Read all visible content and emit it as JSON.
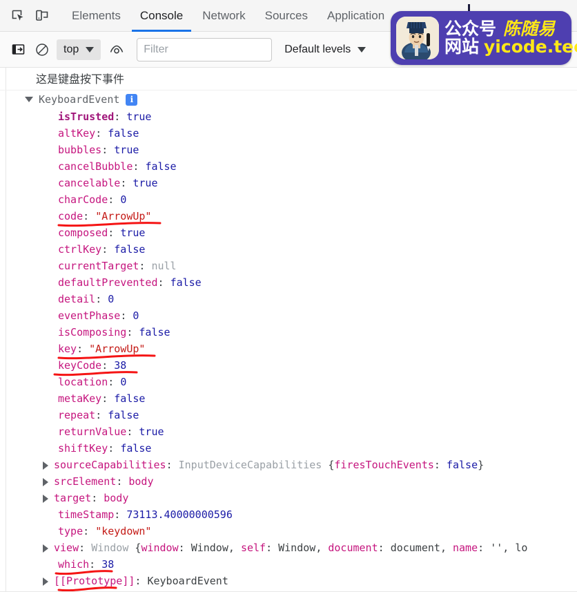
{
  "devtools": {
    "icons": {
      "inspect": "inspect-element-icon",
      "device": "device-toolbar-icon",
      "sidebar": "console-sidebar-icon",
      "clear": "clear-console-icon",
      "eye": "live-expression-icon"
    },
    "tabs": [
      {
        "label": "Elements",
        "active": false
      },
      {
        "label": "Console",
        "active": true
      },
      {
        "label": "Network",
        "active": false
      },
      {
        "label": "Sources",
        "active": false
      },
      {
        "label": "Application",
        "active": false
      }
    ],
    "toolbar": {
      "context": "top",
      "filter_value": "",
      "filter_placeholder": "Filter",
      "levels": "Default levels"
    },
    "accent_color": "#1a73e8",
    "annotation_color": "#f51414"
  },
  "console": {
    "message": "这是键盘按下事件",
    "object_name": "KeyboardEvent",
    "info_badge": "i",
    "properties": [
      {
        "key": "isTrusted",
        "value": "true",
        "type": "bool",
        "own": true,
        "expandable": false
      },
      {
        "key": "altKey",
        "value": "false",
        "type": "bool",
        "own": false,
        "expandable": false
      },
      {
        "key": "bubbles",
        "value": "true",
        "type": "bool",
        "own": false,
        "expandable": false
      },
      {
        "key": "cancelBubble",
        "value": "false",
        "type": "bool",
        "own": false,
        "expandable": false
      },
      {
        "key": "cancelable",
        "value": "true",
        "type": "bool",
        "own": false,
        "expandable": false
      },
      {
        "key": "charCode",
        "value": "0",
        "type": "num",
        "own": false,
        "expandable": false
      },
      {
        "key": "code",
        "value": "\"ArrowUp\"",
        "type": "str",
        "own": false,
        "expandable": false,
        "annotated": true
      },
      {
        "key": "composed",
        "value": "true",
        "type": "bool",
        "own": false,
        "expandable": false
      },
      {
        "key": "ctrlKey",
        "value": "false",
        "type": "bool",
        "own": false,
        "expandable": false
      },
      {
        "key": "currentTarget",
        "value": "null",
        "type": "null",
        "own": false,
        "expandable": false
      },
      {
        "key": "defaultPrevented",
        "value": "false",
        "type": "bool",
        "own": false,
        "expandable": false
      },
      {
        "key": "detail",
        "value": "0",
        "type": "num",
        "own": false,
        "expandable": false
      },
      {
        "key": "eventPhase",
        "value": "0",
        "type": "num",
        "own": false,
        "expandable": false
      },
      {
        "key": "isComposing",
        "value": "false",
        "type": "bool",
        "own": false,
        "expandable": false
      },
      {
        "key": "key",
        "value": "\"ArrowUp\"",
        "type": "str",
        "own": false,
        "expandable": false,
        "annotated": true
      },
      {
        "key": "keyCode",
        "value": "38",
        "type": "num",
        "own": false,
        "expandable": false,
        "annotated": true
      },
      {
        "key": "location",
        "value": "0",
        "type": "num",
        "own": false,
        "expandable": false
      },
      {
        "key": "metaKey",
        "value": "false",
        "type": "bool",
        "own": false,
        "expandable": false
      },
      {
        "key": "repeat",
        "value": "false",
        "type": "bool",
        "own": false,
        "expandable": false
      },
      {
        "key": "returnValue",
        "value": "true",
        "type": "bool",
        "own": false,
        "expandable": false
      },
      {
        "key": "shiftKey",
        "value": "false",
        "type": "bool",
        "own": false,
        "expandable": false
      },
      {
        "key": "sourceCapabilities",
        "value": "InputDeviceCapabilities {firesTouchEvents: false}",
        "type": "preview-idc",
        "own": false,
        "expandable": true
      },
      {
        "key": "srcElement",
        "value": "body",
        "type": "node",
        "own": false,
        "expandable": true
      },
      {
        "key": "target",
        "value": "body",
        "type": "node",
        "own": false,
        "expandable": true
      },
      {
        "key": "timeStamp",
        "value": "73113.40000000596",
        "type": "num",
        "own": false,
        "expandable": false
      },
      {
        "key": "type",
        "value": "\"keydown\"",
        "type": "str",
        "own": false,
        "expandable": false
      },
      {
        "key": "view",
        "value": "Window {window: Window, self: Window, document: document, name: '', lo",
        "type": "preview-window",
        "own": false,
        "expandable": true
      },
      {
        "key": "which",
        "value": "38",
        "type": "num",
        "own": false,
        "expandable": false,
        "annotated": true
      },
      {
        "key": "[[Prototype]]",
        "value": "KeyboardEvent",
        "type": "plain",
        "own": false,
        "expandable": true,
        "annotated": true
      }
    ]
  },
  "watermark": {
    "label_account": "公众号",
    "name": "陈随易",
    "label_site": "网站",
    "site": "yicode.tech",
    "bg_color": "#4e3fb0",
    "highlight_color": "#ffe816"
  }
}
